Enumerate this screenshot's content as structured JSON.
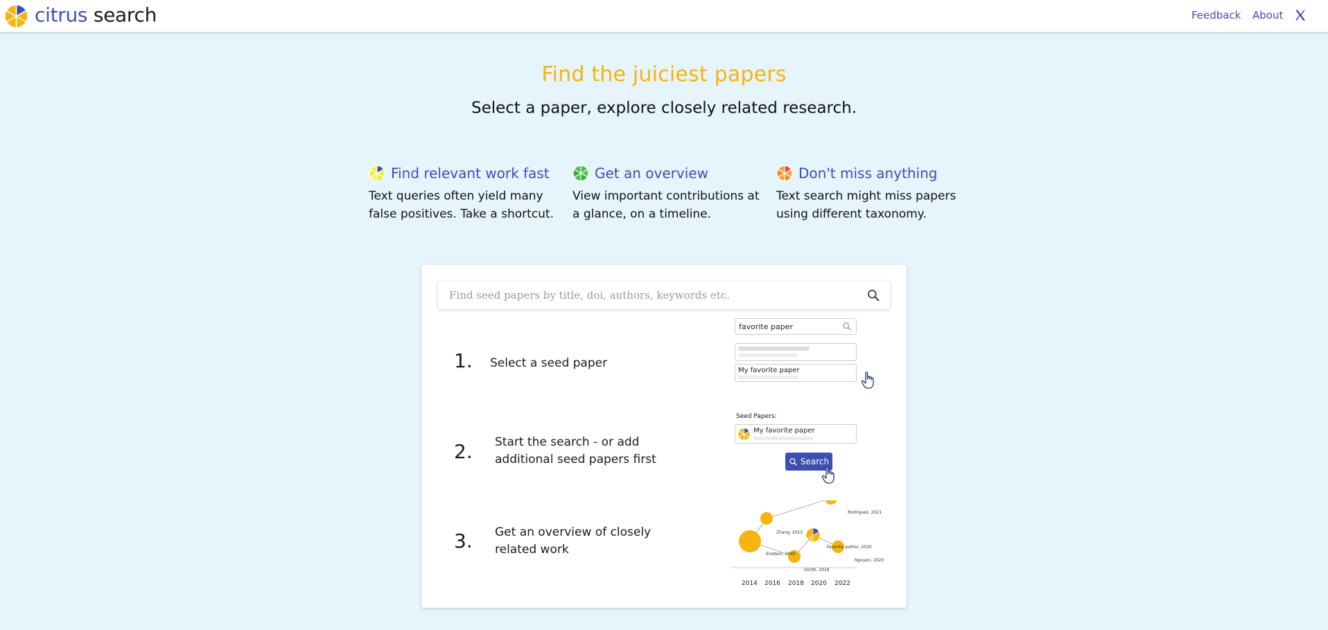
{
  "header": {
    "brand_part1": "citrus",
    "brand_part2": "search",
    "nav": {
      "feedback": "Feedback",
      "about": "About",
      "x_icon": "x-logo-icon"
    }
  },
  "hero": {
    "title": "Find the juiciest papers",
    "subtitle": "Select a paper, explore closely related research."
  },
  "features": [
    {
      "title": "Find relevant work fast",
      "desc": "Text queries often yield many false positives. Take a shortcut.",
      "icon": "lime-slice-icon"
    },
    {
      "title": "Get an overview",
      "desc": "View important contributions at a glance, on a timeline.",
      "icon": "green-citrus-icon"
    },
    {
      "title": "Don't miss anything",
      "desc": "Text search might miss papers using different taxonomy.",
      "icon": "orange-slice-icon"
    }
  ],
  "search": {
    "placeholder": "Find seed papers by title, doi, authors, keywords etc.",
    "icon": "search-icon"
  },
  "steps": [
    {
      "num": "1.",
      "text": "Select a seed paper"
    },
    {
      "num": "2.",
      "text": "Start the search - or add additional seed papers first"
    },
    {
      "num": "3.",
      "text": "Get an overview of closely related work"
    }
  ],
  "illustration": {
    "step1_query": "favorite paper",
    "step1_result": "My favorite paper",
    "step2_label": "Seed Papers:",
    "step2_item": "My favorite paper",
    "step2_button": "Search",
    "step3_nodes": [
      "Rodriguez, 2021",
      "Zhang, 2015",
      "Einstein, 2045",
      "Smith, 2018",
      "Favorite author, 2020",
      "Nguyen, 2020"
    ],
    "step3_years": [
      "2014",
      "2016",
      "2018",
      "2020",
      "2022"
    ]
  },
  "colors": {
    "brand_blue": "#3d4fb0",
    "accent_yellow": "#f6b40e",
    "background": "#e6f4fc"
  }
}
